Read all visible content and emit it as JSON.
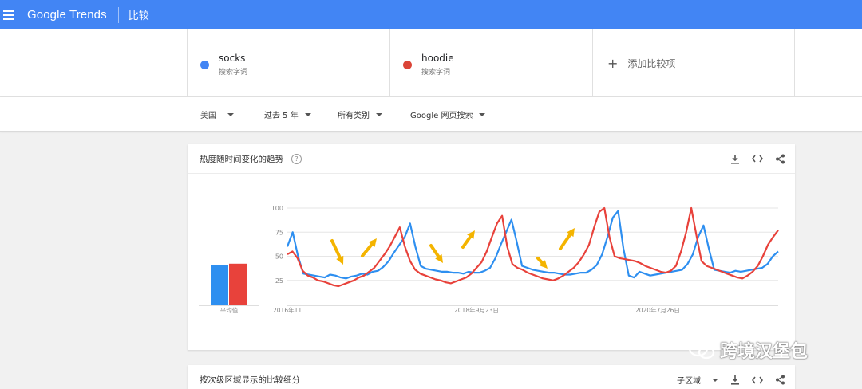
{
  "appbar": {
    "brand_google": "Google",
    "brand_trends": "Trends",
    "page_title": "比较"
  },
  "terms": [
    {
      "name": "socks",
      "sub": "搜索字词",
      "color": "#4285f4"
    },
    {
      "name": "hoodie",
      "sub": "搜索字词",
      "color": "#db4437"
    }
  ],
  "add_term": {
    "label": "添加比较项"
  },
  "filters": {
    "region": "美国",
    "time": "过去 5 年",
    "category": "所有类别",
    "search_type": "Google 网页搜索"
  },
  "interest_card": {
    "title": "热度随时间变化的趋势",
    "help": "?"
  },
  "region_card": {
    "title": "按次级区域显示的比较细分",
    "subregion": "子区域"
  },
  "watermark": {
    "text": "跨境汉堡包"
  },
  "chart_data": {
    "type": "line",
    "y_ticks": [
      "100",
      "75",
      "50",
      "25"
    ],
    "ylim": [
      0,
      100
    ],
    "x_ticks": [
      "2016年11...",
      "2018年9月23日",
      "2020年7月26日"
    ],
    "grid": true,
    "average_label": "平均值",
    "averages": [
      {
        "name": "socks",
        "value": 39,
        "color": "#2e8ff0"
      },
      {
        "name": "hoodie",
        "value": 40,
        "color": "#e8423b"
      }
    ],
    "series": [
      {
        "name": "socks",
        "color": "#2e8ff0",
        "values": [
          60,
          75,
          50,
          32,
          31,
          30,
          29,
          28,
          31,
          30,
          28,
          27,
          29,
          30,
          32,
          31,
          34,
          35,
          39,
          45,
          54,
          62,
          70,
          84,
          60,
          40,
          37,
          36,
          35,
          34,
          34,
          33,
          33,
          32,
          34,
          33,
          33,
          35,
          38,
          48,
          62,
          75,
          88,
          65,
          40,
          38,
          36,
          35,
          34,
          33,
          33,
          32,
          31,
          31,
          32,
          33,
          33,
          36,
          41,
          52,
          70,
          90,
          97,
          58,
          30,
          28,
          34,
          32,
          30,
          31,
          32,
          33,
          34,
          35,
          36,
          42,
          52,
          70,
          82,
          58,
          36,
          35,
          34,
          33,
          35,
          34,
          35,
          36,
          37,
          38,
          42,
          50,
          55
        ]
      },
      {
        "name": "hoodie",
        "color": "#e8423b",
        "values": [
          52,
          55,
          48,
          35,
          30,
          28,
          25,
          24,
          22,
          20,
          19,
          21,
          23,
          25,
          28,
          30,
          34,
          38,
          45,
          52,
          60,
          70,
          80,
          60,
          45,
          36,
          32,
          30,
          28,
          26,
          25,
          23,
          22,
          24,
          26,
          28,
          32,
          38,
          44,
          55,
          70,
          84,
          92,
          60,
          42,
          38,
          36,
          33,
          31,
          29,
          27,
          26,
          25,
          27,
          30,
          34,
          38,
          44,
          52,
          62,
          80,
          96,
          100,
          70,
          50,
          48,
          47,
          46,
          45,
          43,
          40,
          38,
          36,
          34,
          33,
          35,
          40,
          55,
          75,
          100,
          72,
          45,
          40,
          38,
          36,
          34,
          32,
          30,
          28,
          27,
          30,
          34,
          40,
          50,
          62,
          70,
          77
        ]
      }
    ]
  }
}
